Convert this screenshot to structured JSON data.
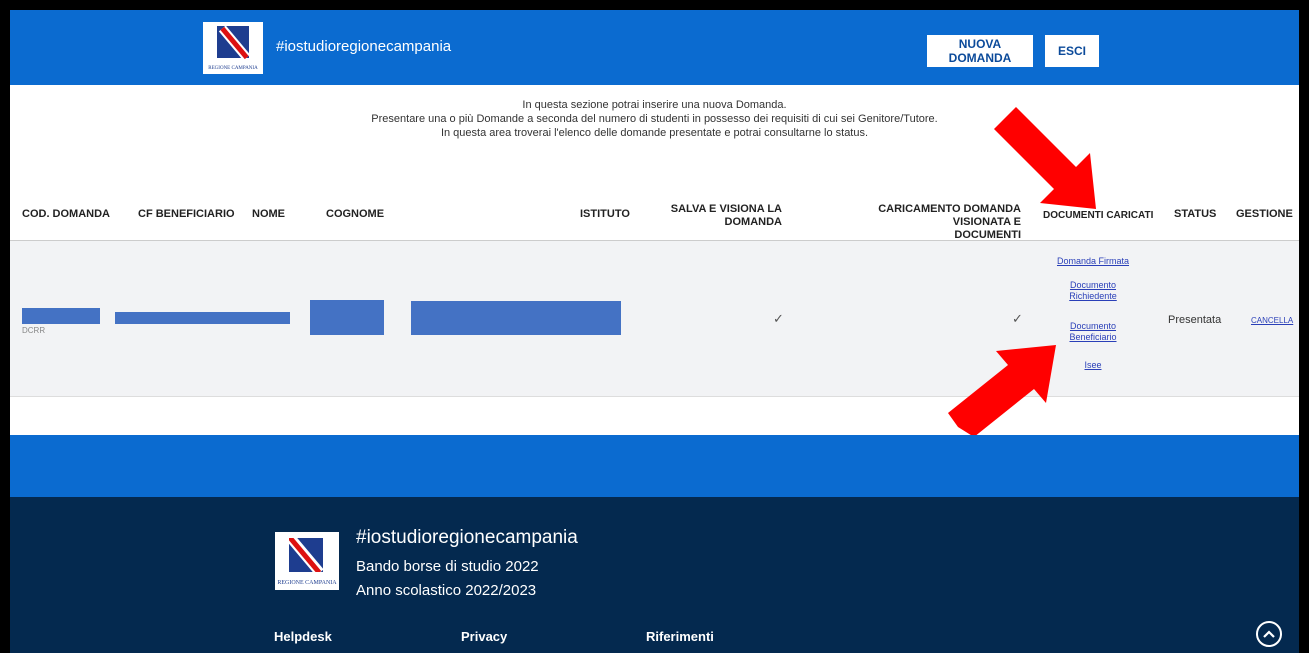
{
  "header": {
    "logo_caption": "REGIONE CAMPANIA",
    "title": "#iostudioregionecampania",
    "buttons": {
      "new": "NUOVA DOMANDA",
      "exit": "ESCI"
    },
    "color": "#0b6bd0"
  },
  "intro": {
    "line1": "In questa sezione potrai inserire una nuova Domanda.",
    "line2": "Presentare una o più Domande a seconda del numero di studenti in possesso dei requisiti di cui sei Genitore/Tutore.",
    "line3": "In questa area troverai l'elenco delle domande presentate e potrai consultarne lo status."
  },
  "table": {
    "columns": {
      "cod": "COD. DOMANDA",
      "cf": "CF BENEFICIARIO",
      "nome": "NOME",
      "cognome": "COGNOME",
      "istituto": "ISTITUTO",
      "salva_1": "SALVA E VISIONA LA",
      "salva_2": "DOMANDA",
      "caric_1": "CARICAMENTO DOMANDA VISIONATA E",
      "caric_2": "DOCUMENTI",
      "docs": "DOCUMENTI CARICATI",
      "status": "STATUS",
      "gestione": "GESTIONE"
    },
    "row": {
      "cod_fragment": "DCRR",
      "salva_check": "✓",
      "caric_check": "✓",
      "docs": {
        "firmata": "Domanda Firmata",
        "richiedente_1": "Documento",
        "richiedente_2": "Richiedente",
        "beneficiario_1": "Documento",
        "beneficiario_2": "Beneficiario",
        "isee": "Isee"
      },
      "status": "Presentata",
      "action": "CANCELLA"
    }
  },
  "footer": {
    "logo_caption": "REGIONE CAMPANIA",
    "title": "#iostudioregionecampania",
    "line1": "Bando borse di studio 2022",
    "line2": "Anno scolastico 2022/2023",
    "links": {
      "helpdesk": "Helpdesk",
      "privacy": "Privacy",
      "riferimenti": "Riferimenti"
    },
    "scroll_top_icon": "chevron-up-icon",
    "color": "#04294f"
  },
  "annotations": {
    "arrow_color": "#ff0000"
  }
}
